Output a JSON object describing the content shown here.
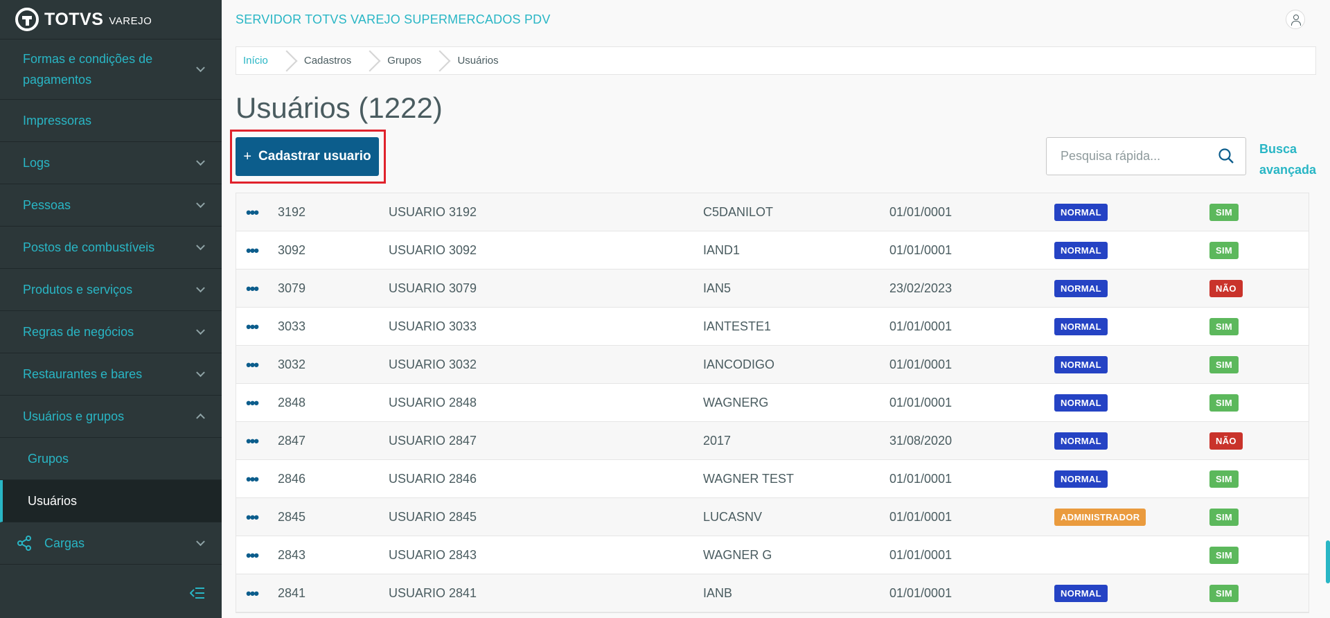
{
  "brand": {
    "name": "TOTVS",
    "sub": "VAREJO"
  },
  "header": {
    "title": "SERVIDOR TOTVS VAREJO SUPERMERCADOS PDV"
  },
  "sidebar": {
    "items": [
      {
        "label": "Formas e condições de pagamentos",
        "chevron": "down"
      },
      {
        "label": "Impressoras"
      },
      {
        "label": "Logs",
        "chevron": "down"
      },
      {
        "label": "Pessoas",
        "chevron": "down"
      },
      {
        "label": "Postos de combustíveis",
        "chevron": "down"
      },
      {
        "label": "Produtos e serviços",
        "chevron": "down"
      },
      {
        "label": "Regras de negócios",
        "chevron": "down"
      },
      {
        "label": "Restaurantes e bares",
        "chevron": "down"
      },
      {
        "label": "Usuários e grupos",
        "chevron": "up"
      },
      {
        "label": "Grupos"
      },
      {
        "label": "Usuários"
      },
      {
        "label": "Cargas",
        "chevron": "down",
        "icon": "share-icon"
      }
    ]
  },
  "breadcrumb": [
    "Início",
    "Cadastros",
    "Grupos",
    "Usuários"
  ],
  "page": {
    "title": "Usuários (1222)",
    "add_button": "Cadastrar usuario",
    "search_placeholder": "Pesquisa rápida...",
    "advanced_search": "Busca avançada"
  },
  "table": {
    "rows": [
      {
        "code": "3192",
        "name": "USUARIO 3192",
        "login": "C5DANILOT",
        "date": "01/01/0001",
        "type": "NORMAL",
        "active": "SIM"
      },
      {
        "code": "3092",
        "name": "USUARIO 3092",
        "login": "IAND1",
        "date": "01/01/0001",
        "type": "NORMAL",
        "active": "SIM"
      },
      {
        "code": "3079",
        "name": "USUARIO 3079",
        "login": "IAN5",
        "date": "23/02/2023",
        "type": "NORMAL",
        "active": "NÃO"
      },
      {
        "code": "3033",
        "name": "USUARIO 3033",
        "login": "IANTESTE1",
        "date": "01/01/0001",
        "type": "NORMAL",
        "active": "SIM"
      },
      {
        "code": "3032",
        "name": "USUARIO 3032",
        "login": "IANCODIGO",
        "date": "01/01/0001",
        "type": "NORMAL",
        "active": "SIM"
      },
      {
        "code": "2848",
        "name": "USUARIO 2848",
        "login": "WAGNERG",
        "date": "01/01/0001",
        "type": "NORMAL",
        "active": "SIM"
      },
      {
        "code": "2847",
        "name": "USUARIO 2847",
        "login": "2017",
        "date": "31/08/2020",
        "type": "NORMAL",
        "active": "NÃO"
      },
      {
        "code": "2846",
        "name": "USUARIO 2846",
        "login": "WAGNER TEST",
        "date": "01/01/0001",
        "type": "NORMAL",
        "active": "SIM"
      },
      {
        "code": "2845",
        "name": "USUARIO 2845",
        "login": "LUCASNV",
        "date": "01/01/0001",
        "type": "ADMINISTRADOR",
        "active": "SIM"
      },
      {
        "code": "2843",
        "name": "USUARIO 2843",
        "login": "WAGNER G",
        "date": "01/01/0001",
        "type": "",
        "active": "SIM"
      },
      {
        "code": "2841",
        "name": "USUARIO 2841",
        "login": "IANB",
        "date": "01/01/0001",
        "type": "NORMAL",
        "active": "SIM"
      }
    ]
  },
  "colors": {
    "accent": "#29b6c5",
    "primary_button": "#0c5d8c",
    "sidebar_bg": "#2c3739",
    "badge_normal": "#2543c4",
    "badge_admin": "#ea9b3e",
    "badge_sim": "#5cb85c",
    "badge_nao": "#c9332b",
    "highlight": "#e0222c"
  }
}
